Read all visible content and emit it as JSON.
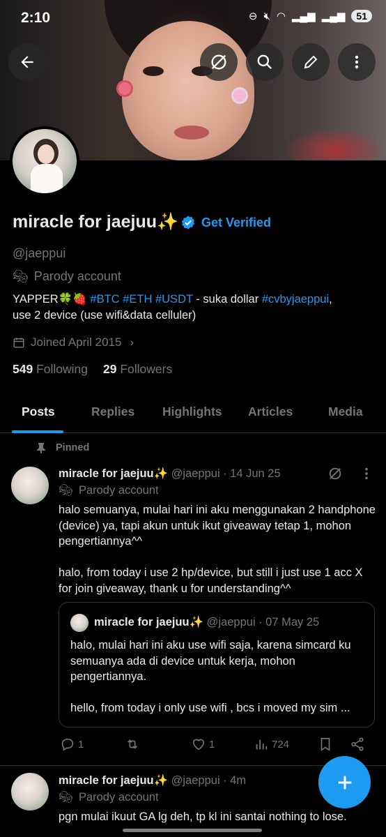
{
  "status_bar": {
    "time": "2:10",
    "battery": "51"
  },
  "profile": {
    "display_name": "miracle for jaejuu✨",
    "get_verified_label": "Get Verified",
    "handle": "@jaeppui",
    "parody_label": "Parody account",
    "bio_prefix": "YAPPER🍀🍓 ",
    "bio_tags": [
      "#BTC",
      "#ETH",
      "#USDT"
    ],
    "bio_middle": " - suka dollar ",
    "bio_tag_end": "#cvbyjaeppui",
    "bio_suffix": ",",
    "bio_line2": "use 2 device (use wifi&data celluler)",
    "joined": "Joined April 2015",
    "following_count": "549",
    "following_label": "Following",
    "followers_count": "29",
    "followers_label": "Followers"
  },
  "tabs": [
    "Posts",
    "Replies",
    "Highlights",
    "Articles",
    "Media"
  ],
  "pinned_label": "Pinned",
  "pinned_post": {
    "name": "miracle for jaejuu✨",
    "handle": "@jaeppui",
    "date": "· 14 Jun 25",
    "parody_label": "Parody account",
    "text": "halo semuanya, mulai hari ini aku menggunakan 2 handphone (device) ya, tapi akun untuk ikut giveaway tetap 1, mohon pengertiannya^^\n\nhalo, from today i use 2 hp/device, but still i just use 1 acc X for join giveaway, thank u for understanding^^",
    "quote": {
      "name": "miracle for jaejuu✨",
      "handle": "@jaeppui",
      "date": "· 07 May 25",
      "text": "halo, mulai hari ini aku use wifi saja, karena simcard ku semuanya ada di device untuk kerja, mohon pengertiannya.\n\nhello, from today i only use wifi , bcs i moved my sim ..."
    },
    "replies": "1",
    "reposts": "",
    "likes": "1",
    "views": "724"
  },
  "second_post": {
    "name": "miracle for jaejuu✨",
    "handle": "@jaeppui",
    "time": "· 4m",
    "parody_label": "Parody account",
    "text": "pgn mulai ikuut GA lg deh, tp kl ini santai nothing to lose."
  },
  "colors": {
    "accent": "#1d9bf0",
    "background": "#000000",
    "muted": "#71767b"
  }
}
